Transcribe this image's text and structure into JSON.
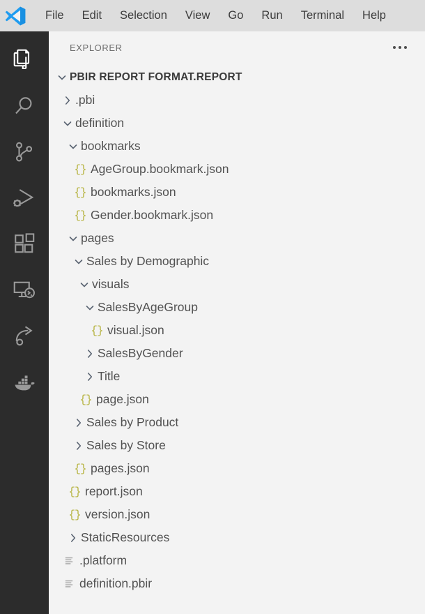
{
  "window": {
    "logo_name": "vscode-logo"
  },
  "menubar": {
    "items": [
      {
        "label": "File",
        "name": "menu-file"
      },
      {
        "label": "Edit",
        "name": "menu-edit"
      },
      {
        "label": "Selection",
        "name": "menu-selection"
      },
      {
        "label": "View",
        "name": "menu-view"
      },
      {
        "label": "Go",
        "name": "menu-go"
      },
      {
        "label": "Run",
        "name": "menu-run"
      },
      {
        "label": "Terminal",
        "name": "menu-terminal"
      },
      {
        "label": "Help",
        "name": "menu-help"
      }
    ]
  },
  "activitybar": {
    "items": [
      {
        "icon": "files-explorer-icon",
        "active": true
      },
      {
        "icon": "search-icon",
        "active": false
      },
      {
        "icon": "source-control-icon",
        "active": false
      },
      {
        "icon": "run-and-debug-icon",
        "active": false
      },
      {
        "icon": "extensions-icon",
        "active": false
      },
      {
        "icon": "remote-explorer-icon",
        "active": false
      },
      {
        "icon": "share-arrow-icon",
        "active": false
      },
      {
        "icon": "docker-whale-icon",
        "active": false
      }
    ]
  },
  "sidebar": {
    "title": "EXPLORER",
    "more_actions_icon": "ellipsis-icon"
  },
  "tree": {
    "rows": [
      {
        "label": "PBIR REPORT FORMAT.REPORT",
        "depth": 0,
        "kind": "folder",
        "state": "expanded",
        "root": true
      },
      {
        "label": ".pbi",
        "depth": 1,
        "kind": "folder",
        "state": "collapsed"
      },
      {
        "label": "definition",
        "depth": 1,
        "kind": "folder",
        "state": "expanded"
      },
      {
        "label": "bookmarks",
        "depth": 2,
        "kind": "folder",
        "state": "expanded"
      },
      {
        "label": "AgeGroup.bookmark.json",
        "depth": 3,
        "kind": "json"
      },
      {
        "label": "bookmarks.json",
        "depth": 3,
        "kind": "json"
      },
      {
        "label": "Gender.bookmark.json",
        "depth": 3,
        "kind": "json"
      },
      {
        "label": "pages",
        "depth": 2,
        "kind": "folder",
        "state": "expanded"
      },
      {
        "label": "Sales by Demographic",
        "depth": 3,
        "kind": "folder",
        "state": "expanded"
      },
      {
        "label": "visuals",
        "depth": 4,
        "kind": "folder",
        "state": "expanded"
      },
      {
        "label": "SalesByAgeGroup",
        "depth": 5,
        "kind": "folder",
        "state": "expanded"
      },
      {
        "label": "visual.json",
        "depth": 6,
        "kind": "json"
      },
      {
        "label": "SalesByGender",
        "depth": 5,
        "kind": "folder",
        "state": "collapsed"
      },
      {
        "label": "Title",
        "depth": 5,
        "kind": "folder",
        "state": "collapsed"
      },
      {
        "label": "page.json",
        "depth": 4,
        "kind": "json"
      },
      {
        "label": "Sales by Product",
        "depth": 3,
        "kind": "folder",
        "state": "collapsed"
      },
      {
        "label": "Sales by Store",
        "depth": 3,
        "kind": "folder",
        "state": "collapsed"
      },
      {
        "label": "pages.json",
        "depth": 3,
        "kind": "json"
      },
      {
        "label": "report.json",
        "depth": 2,
        "kind": "json"
      },
      {
        "label": "version.json",
        "depth": 2,
        "kind": "json"
      },
      {
        "label": "StaticResources",
        "depth": 2,
        "kind": "folder",
        "state": "collapsed"
      },
      {
        "label": ".platform",
        "depth": 1,
        "kind": "file"
      },
      {
        "label": "definition.pbir",
        "depth": 1,
        "kind": "file"
      }
    ]
  },
  "colors": {
    "menubar_bg": "#dddddd",
    "activitybar_bg": "#2c2c2c",
    "sidebar_bg": "#f3f3f3",
    "text": "#525252",
    "json_icon": "#b7b442",
    "chevron": "#5a6472",
    "logo_blue": "#0f7ac8"
  }
}
